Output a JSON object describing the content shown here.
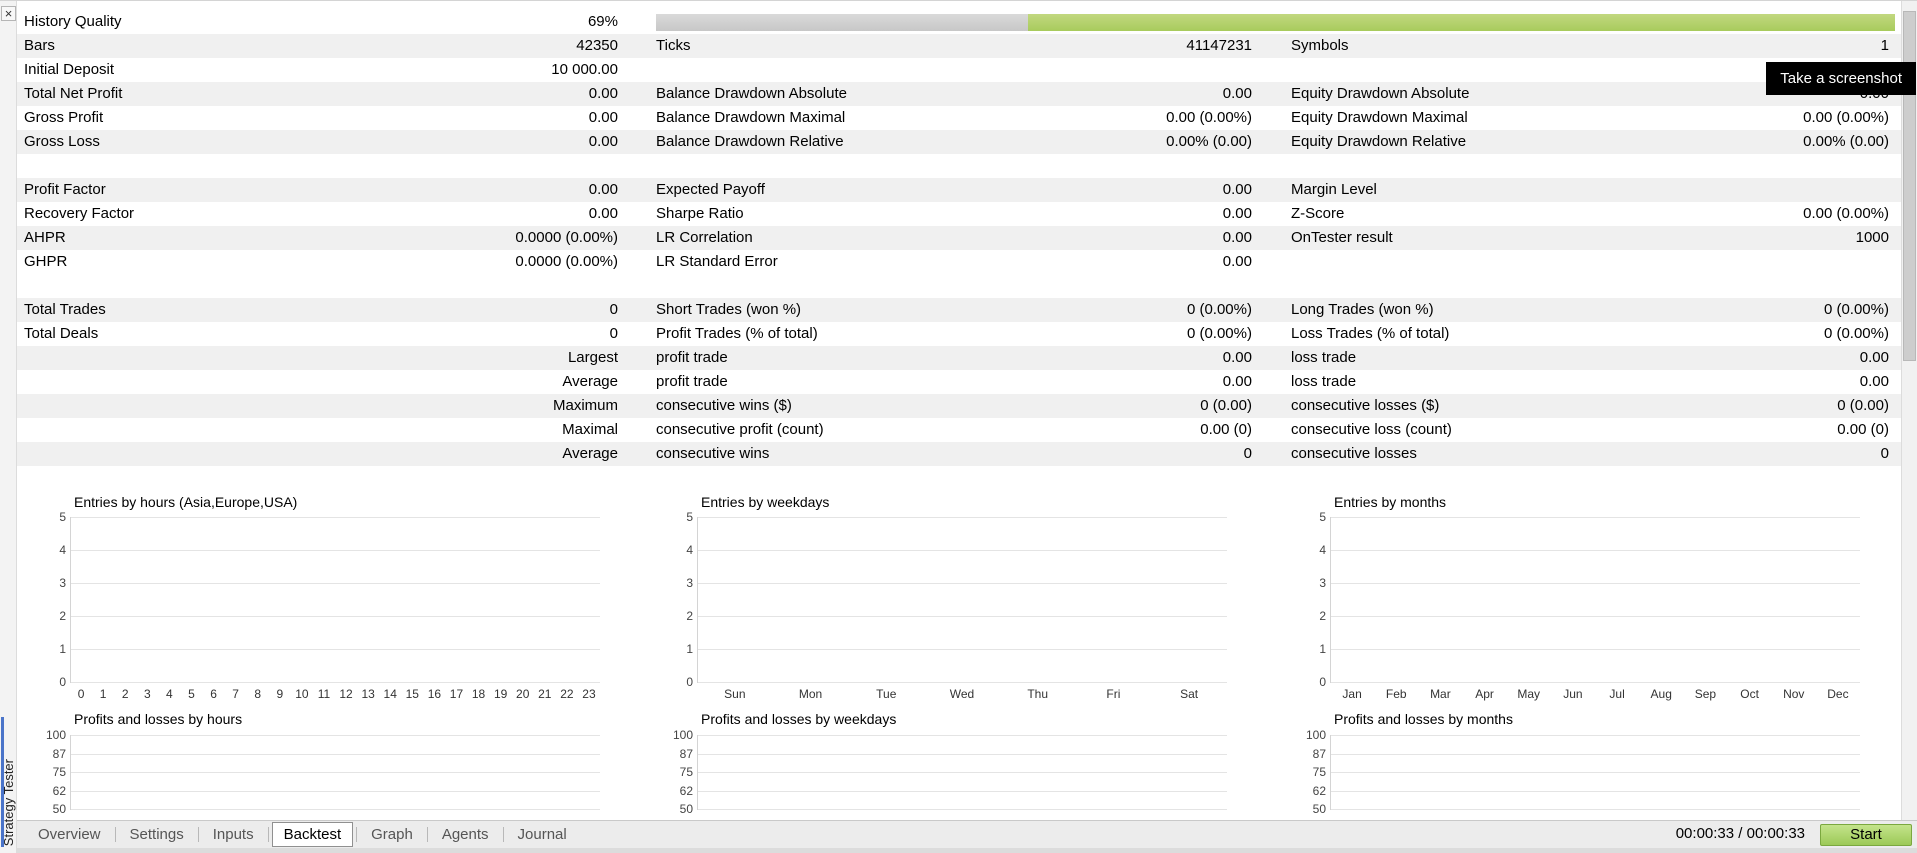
{
  "panel": {
    "title_vertical": "Strategy Tester",
    "close_label": "×"
  },
  "tooltip": {
    "text": "Take a screenshot"
  },
  "colors": {
    "progress_gray": "#c7c7c7",
    "progress_green": "#a8cb5c",
    "start_button_green": "#9cc957",
    "accent_blue": "#4a74c9"
  },
  "stats": {
    "progress": {
      "value_label": "69%",
      "gray_fraction": 0.3
    },
    "rows": [
      {
        "bg": "w",
        "progress": true,
        "cells": [
          [
            "History Quality",
            "69%"
          ],
          null,
          null
        ]
      },
      {
        "bg": "g",
        "cells": [
          [
            "Bars",
            "42350"
          ],
          [
            "Ticks",
            "41147231"
          ],
          [
            "Symbols",
            "1"
          ]
        ]
      },
      {
        "bg": "w",
        "cells": [
          [
            "Initial Deposit",
            "10 000.00"
          ],
          null,
          null
        ]
      },
      {
        "bg": "g",
        "cells": [
          [
            "Total Net Profit",
            "0.00"
          ],
          [
            "Balance Drawdown Absolute",
            "0.00"
          ],
          [
            "Equity Drawdown Absolute",
            "0.00"
          ]
        ]
      },
      {
        "bg": "w",
        "cells": [
          [
            "Gross Profit",
            "0.00"
          ],
          [
            "Balance Drawdown Maximal",
            "0.00 (0.00%)"
          ],
          [
            "Equity Drawdown Maximal",
            "0.00 (0.00%)"
          ]
        ]
      },
      {
        "bg": "g",
        "cells": [
          [
            "Gross Loss",
            "0.00"
          ],
          [
            "Balance Drawdown Relative",
            "0.00% (0.00)"
          ],
          [
            "Equity Drawdown Relative",
            "0.00% (0.00)"
          ]
        ]
      },
      {
        "bg": "w",
        "cells": [
          null,
          null,
          null
        ]
      },
      {
        "bg": "g",
        "cells": [
          [
            "Profit Factor",
            "0.00"
          ],
          [
            "Expected Payoff",
            "0.00"
          ],
          [
            "Margin Level",
            ""
          ]
        ]
      },
      {
        "bg": "w",
        "cells": [
          [
            "Recovery Factor",
            "0.00"
          ],
          [
            "Sharpe Ratio",
            "0.00"
          ],
          [
            "Z-Score",
            "0.00 (0.00%)"
          ]
        ]
      },
      {
        "bg": "g",
        "cells": [
          [
            "AHPR",
            "0.0000 (0.00%)"
          ],
          [
            "LR Correlation",
            "0.00"
          ],
          [
            "OnTester result",
            "1000"
          ]
        ]
      },
      {
        "bg": "w",
        "cells": [
          [
            "GHPR",
            "0.0000 (0.00%)"
          ],
          [
            "LR Standard Error",
            "0.00"
          ],
          null
        ]
      },
      {
        "bg": "w",
        "cells": [
          null,
          null,
          null
        ]
      },
      {
        "bg": "g",
        "cells": [
          [
            "Total Trades",
            "0"
          ],
          [
            "Short Trades (won %)",
            "0 (0.00%)"
          ],
          [
            "Long Trades (won %)",
            "0 (0.00%)"
          ]
        ]
      },
      {
        "bg": "w",
        "cells": [
          [
            "Total Deals",
            "0"
          ],
          [
            "Profit Trades (% of total)",
            "0 (0.00%)"
          ],
          [
            "Loss Trades (% of total)",
            "0 (0.00%)"
          ]
        ]
      },
      {
        "bg": "g",
        "cells": [
          [
            "",
            "Largest"
          ],
          [
            "profit trade",
            "0.00"
          ],
          [
            "loss trade",
            "0.00"
          ]
        ]
      },
      {
        "bg": "w",
        "cells": [
          [
            "",
            "Average"
          ],
          [
            "profit trade",
            "0.00"
          ],
          [
            "loss trade",
            "0.00"
          ]
        ]
      },
      {
        "bg": "g",
        "cells": [
          [
            "",
            "Maximum"
          ],
          [
            "consecutive wins ($)",
            "0 (0.00)"
          ],
          [
            "consecutive losses ($)",
            "0 (0.00)"
          ]
        ]
      },
      {
        "bg": "w",
        "cells": [
          [
            "",
            "Maximal"
          ],
          [
            "consecutive profit (count)",
            "0.00 (0)"
          ],
          [
            "consecutive loss (count)",
            "0.00 (0)"
          ]
        ]
      },
      {
        "bg": "g",
        "cells": [
          [
            "",
            "Average"
          ],
          [
            "consecutive wins",
            "0"
          ],
          [
            "consecutive losses",
            "0"
          ]
        ]
      }
    ]
  },
  "charts": {
    "top": [
      {
        "title": "Entries by hours (Asia,Europe,USA)",
        "y_ticks": [
          "5",
          "4",
          "3",
          "2",
          "1",
          "0"
        ],
        "x_labels": [
          "0",
          "1",
          "2",
          "3",
          "4",
          "5",
          "6",
          "7",
          "8",
          "9",
          "10",
          "11",
          "12",
          "13",
          "14",
          "15",
          "16",
          "17",
          "18",
          "19",
          "20",
          "21",
          "22",
          "23"
        ],
        "values": []
      },
      {
        "title": "Entries by weekdays",
        "y_ticks": [
          "5",
          "4",
          "3",
          "2",
          "1",
          "0"
        ],
        "x_labels": [
          "Sun",
          "Mon",
          "Tue",
          "Wed",
          "Thu",
          "Fri",
          "Sat"
        ],
        "values": []
      },
      {
        "title": "Entries by months",
        "y_ticks": [
          "5",
          "4",
          "3",
          "2",
          "1",
          "0"
        ],
        "x_labels": [
          "Jan",
          "Feb",
          "Mar",
          "Apr",
          "May",
          "Jun",
          "Jul",
          "Aug",
          "Sep",
          "Oct",
          "Nov",
          "Dec"
        ],
        "values": []
      }
    ],
    "bottom": [
      {
        "title": "Profits and losses by hours",
        "y_ticks": [
          "100",
          "87",
          "75",
          "62",
          "50"
        ],
        "values": []
      },
      {
        "title": "Profits and losses by weekdays",
        "y_ticks": [
          "100",
          "87",
          "75",
          "62",
          "50"
        ],
        "values": []
      },
      {
        "title": "Profits and losses by months",
        "y_ticks": [
          "100",
          "87",
          "75",
          "62",
          "50"
        ],
        "values": []
      }
    ]
  },
  "tabbar": {
    "tabs": [
      "Overview",
      "Settings",
      "Inputs",
      "Backtest",
      "Graph",
      "Agents",
      "Journal"
    ],
    "active": "Backtest",
    "time": "00:00:33 / 00:00:33",
    "start_label": "Start"
  }
}
